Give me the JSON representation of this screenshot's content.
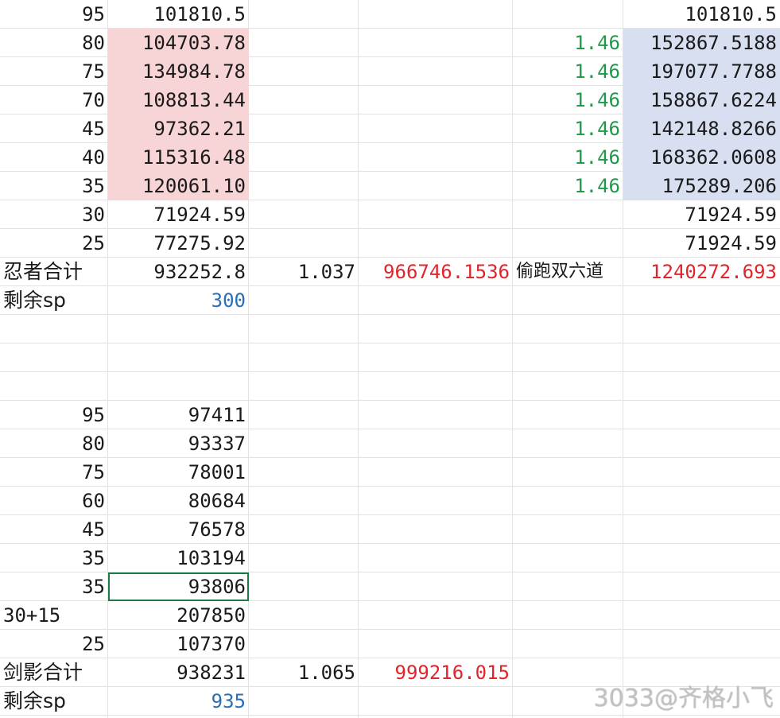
{
  "block1": {
    "rows": [
      {
        "a": "95",
        "b": "101810.5",
        "e": "",
        "f": "101810.5",
        "b_hl": false,
        "f_hl": false
      },
      {
        "a": "80",
        "b": "104703.78",
        "e": "1.46",
        "f": "152867.5188",
        "b_hl": true,
        "f_hl": true
      },
      {
        "a": "75",
        "b": "134984.78",
        "e": "1.46",
        "f": "197077.7788",
        "b_hl": true,
        "f_hl": true
      },
      {
        "a": "70",
        "b": "108813.44",
        "e": "1.46",
        "f": "158867.6224",
        "b_hl": true,
        "f_hl": true
      },
      {
        "a": "45",
        "b": "97362.21",
        "e": "1.46",
        "f": "142148.8266",
        "b_hl": true,
        "f_hl": true
      },
      {
        "a": "40",
        "b": "115316.48",
        "e": "1.46",
        "f": "168362.0608",
        "b_hl": true,
        "f_hl": true
      },
      {
        "a": "35",
        "b": "120061.10",
        "e": "1.46",
        "f": "175289.206",
        "b_hl": true,
        "f_hl": true
      },
      {
        "a": "30",
        "b": "71924.59",
        "e": "",
        "f": "71924.59",
        "b_hl": false,
        "f_hl": false
      },
      {
        "a": "25",
        "b": "77275.92",
        "e": "",
        "f": "71924.59",
        "b_hl": false,
        "f_hl": false
      }
    ],
    "total": {
      "label": "忍者合计",
      "b": "932252.8",
      "c": "1.037",
      "d": "966746.1536",
      "e": "偷跑双六道",
      "f": "1240272.693"
    },
    "remaining": {
      "label": "剩余sp",
      "b": "300"
    }
  },
  "block2": {
    "rows": [
      {
        "a": "95",
        "b": "97411"
      },
      {
        "a": "80",
        "b": "93337"
      },
      {
        "a": "75",
        "b": "78001"
      },
      {
        "a": "60",
        "b": "80684"
      },
      {
        "a": "45",
        "b": "76578"
      },
      {
        "a": "35",
        "b": "103194"
      },
      {
        "a": "35",
        "b": "93806"
      },
      {
        "a": "30+15",
        "b": "207850"
      },
      {
        "a": "25",
        "b": "107370"
      }
    ],
    "total": {
      "label": "剑影合计",
      "b": "938231",
      "c": "1.065",
      "d": "999216.015"
    },
    "remaining": {
      "label": "剩余sp",
      "b": "935"
    }
  },
  "watermark": "3033@齐格小飞",
  "colors": {
    "pink": "#f7d4d6",
    "blue": "#d7dff0",
    "green": "#1f9a4a",
    "red": "#e0252b",
    "sp_blue": "#2a6fb5",
    "selection": "#1e7a45"
  }
}
